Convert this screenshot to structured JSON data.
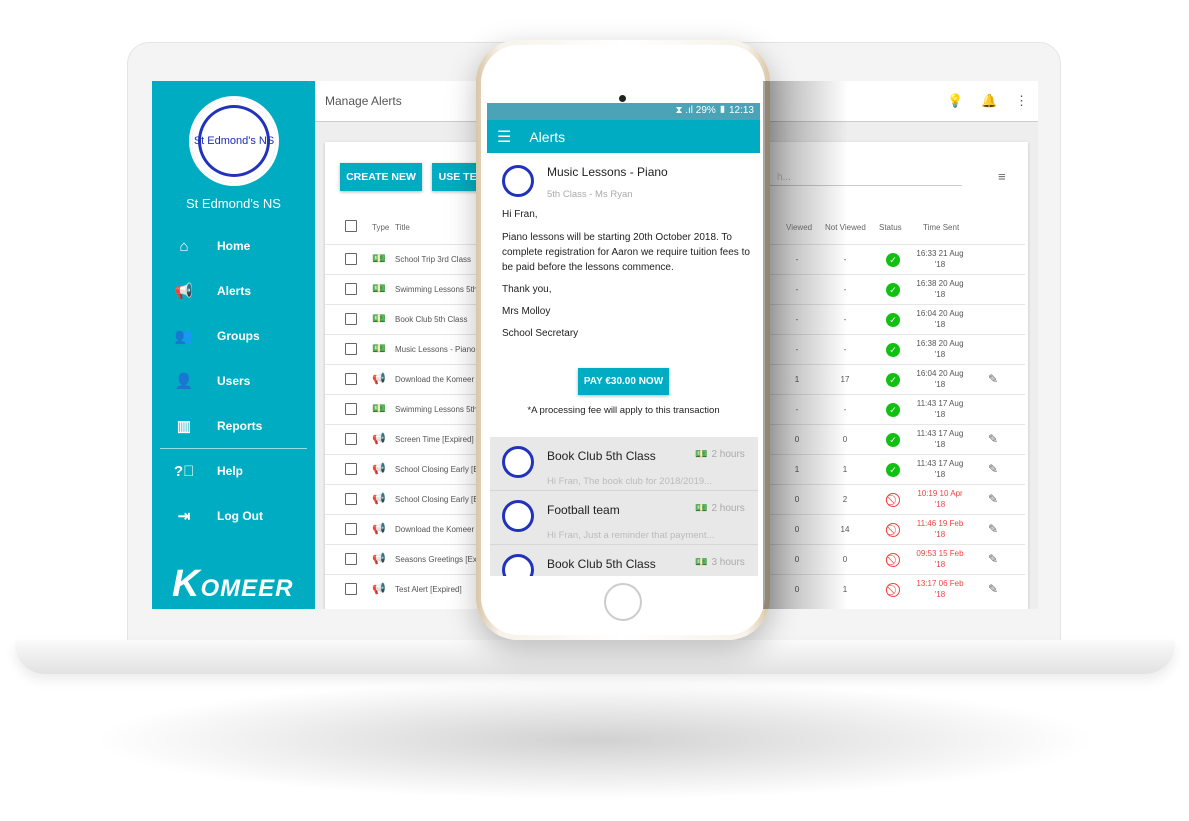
{
  "sidebar": {
    "school_name": "St Edmond's NS",
    "logo_text": "St Edmond's NS",
    "items": [
      {
        "label": "Home",
        "icon": "home-icon"
      },
      {
        "label": "Alerts",
        "icon": "megaphone-icon"
      },
      {
        "label": "Groups",
        "icon": "group-icon"
      },
      {
        "label": "Users",
        "icon": "user-icon"
      },
      {
        "label": "Reports",
        "icon": "chart-icon"
      },
      {
        "label": "Help",
        "icon": "help-icon"
      },
      {
        "label": "Log Out",
        "icon": "logout-icon"
      }
    ],
    "brand": "KOMEER",
    "brand_k": "K",
    "brand_rest": "OMEER"
  },
  "header": {
    "title": "Manage Alerts"
  },
  "toolbar": {
    "create_new": "CREATE NEW",
    "use_template": "USE TEM",
    "search_placeholder": "h..."
  },
  "table": {
    "headers": {
      "type": "Type",
      "title": "Title",
      "viewed": "Viewed",
      "not_viewed": "Not Viewed",
      "status": "Status",
      "time_sent": "Time Sent"
    },
    "rows": [
      {
        "type": "payment",
        "title": "School Trip 3rd Class",
        "viewed": "-",
        "not_viewed": "-",
        "status": "sent",
        "time": "16:33  21 Aug",
        "year": "'18",
        "edit": false
      },
      {
        "type": "payment",
        "title": "Swimming Lessons 5th",
        "viewed": "-",
        "not_viewed": "-",
        "status": "sent",
        "time": "16:38  20 Aug",
        "year": "'18",
        "edit": false
      },
      {
        "type": "payment",
        "title": "Book Club 5th Class",
        "viewed": "-",
        "not_viewed": "-",
        "status": "sent",
        "time": "16:04  20 Aug",
        "year": "'18",
        "edit": false
      },
      {
        "type": "payment",
        "title": "Music Lessons - Piano",
        "viewed": "-",
        "not_viewed": "-",
        "status": "sent",
        "time": "16:38  20 Aug",
        "year": "'18",
        "edit": false
      },
      {
        "type": "alert",
        "title": "Download the Komeer",
        "viewed": "1",
        "not_viewed": "17",
        "status": "sent",
        "time": "16:04  20 Aug",
        "year": "'18",
        "edit": true
      },
      {
        "type": "payment",
        "title": "Swimming Lessons 5th",
        "viewed": "-",
        "not_viewed": "-",
        "status": "sent",
        "time": "11:43  17 Aug",
        "year": "'18",
        "edit": false
      },
      {
        "type": "alert",
        "title": "Screen Time [Expired]",
        "viewed": "0",
        "not_viewed": "0",
        "status": "sent",
        "time": "11:43  17 Aug",
        "year": "'18",
        "edit": true
      },
      {
        "type": "alert",
        "title": "School Closing Early [E",
        "viewed": "1",
        "not_viewed": "1",
        "status": "sent",
        "time": "11:43  17 Aug",
        "year": "'18",
        "edit": true
      },
      {
        "type": "alert",
        "title": "School Closing Early [E",
        "viewed": "0",
        "not_viewed": "2",
        "status": "expired",
        "time": "10:19  10 Apr",
        "year": "'18",
        "edit": true
      },
      {
        "type": "alert",
        "title": "Download the Komeer",
        "viewed": "0",
        "not_viewed": "14",
        "status": "expired",
        "time": "11:46  19 Feb",
        "year": "'18",
        "edit": true
      },
      {
        "type": "alert",
        "title": "Seasons Greetings [Ex",
        "viewed": "0",
        "not_viewed": "0",
        "status": "expired",
        "time": "09:53  15 Feb",
        "year": "'18",
        "edit": true
      },
      {
        "type": "alert",
        "title": "Test Alert [Expired]",
        "viewed": "0",
        "not_viewed": "1",
        "status": "expired",
        "time": "13:17  06 Feb",
        "year": "'18",
        "edit": true
      }
    ]
  },
  "colors": {
    "primary": "#00acc1",
    "success": "#12c012",
    "danger": "#f04444"
  },
  "phone": {
    "status_bar": "⧗ .ıl 29% ▮ 12:13",
    "app_title": "Alerts",
    "detail": {
      "title": "Music Lessons - Piano",
      "subtitle": "5th Class - Ms Ryan",
      "greeting": "Hi Fran,",
      "body": "Piano lessons will be starting 20th October 2018. To complete registration for Aaron we require tuition fees to be paid before the lessons commence.",
      "thanks": "Thank you,",
      "signature": "Mrs Molloy",
      "role": "School Secretary",
      "pay_button": "PAY €30.00 NOW",
      "fee_note": "*A processing fee will apply to this transaction"
    },
    "list": [
      {
        "title": "Book Club 5th Class",
        "time": "2 hours",
        "preview": "Hi Fran, The book club for 2018/2019..."
      },
      {
        "title": "Football team",
        "time": "2 hours",
        "preview": "Hi Fran, Just a reminder that payment..."
      },
      {
        "title": "Book Club 5th Class",
        "time": "3 hours",
        "preview": ""
      }
    ]
  }
}
